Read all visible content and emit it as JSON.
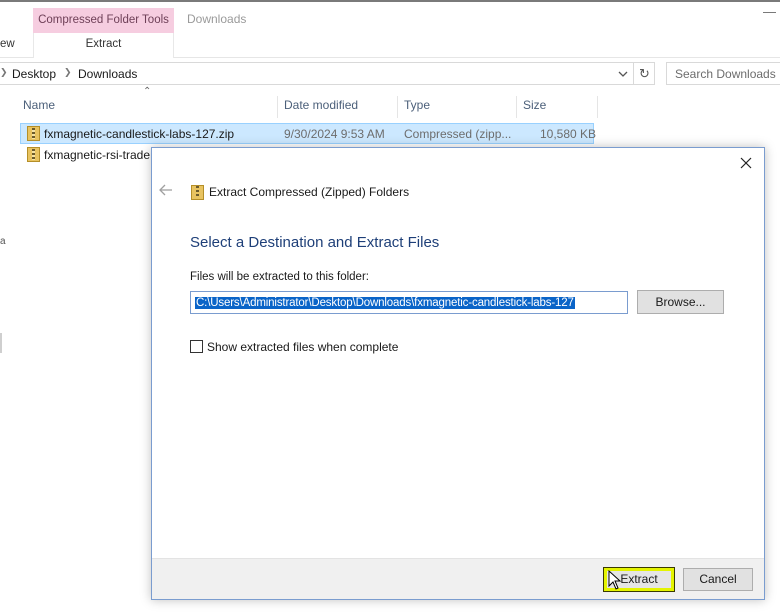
{
  "ribbon": {
    "context_tab_group": "Compressed Folder Tools",
    "context_tab": "Extract",
    "window_title": "Downloads",
    "view_tab_fragment": "ew",
    "minimize_glyph": "—"
  },
  "address": {
    "crumbs": [
      "Desktop",
      "Downloads"
    ],
    "search_placeholder": "Search Downloads"
  },
  "columns": {
    "name": "Name",
    "date": "Date modified",
    "type": "Type",
    "size": "Size"
  },
  "files": [
    {
      "name": "fxmagnetic-candlestick-labs-127.zip",
      "date": "9/30/2024 9:53 AM",
      "type": "Compressed (zipp...",
      "size": "10,580 KB",
      "selected": true
    },
    {
      "name": "fxmagnetic-rsi-trade",
      "selected": false
    }
  ],
  "left_fragment": "a",
  "dialog": {
    "title": "Extract Compressed (Zipped) Folders",
    "heading": "Select a Destination and Extract Files",
    "folder_label": "Files will be extracted to this folder:",
    "path_value": "C:\\Users\\Administrator\\Desktop\\Downloads\\fxmagnetic-candlestick-labs-127",
    "browse_label": "Browse...",
    "checkbox_label": "Show extracted files when complete",
    "checkbox_checked": false,
    "extract_label": "Extract",
    "cancel_label": "Cancel"
  },
  "colors": {
    "context_tab_bg": "#f6cde0",
    "selection_bg": "#cce8ff",
    "heading_blue": "#1e3f78",
    "path_highlight": "#0a64c8",
    "extract_highlight": "#e4f400"
  }
}
